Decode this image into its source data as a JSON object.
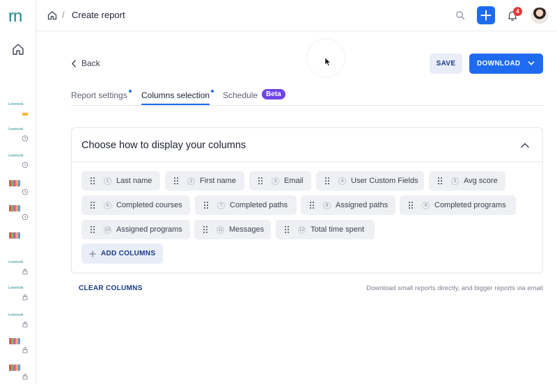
{
  "app": {
    "brand": "rn"
  },
  "header": {
    "breadcrumb_sep": "/",
    "title": "Create report",
    "notification_count": "4"
  },
  "rail": {
    "items": [
      {
        "kind": "text",
        "label": "Learnook",
        "badge": "crown-icon"
      },
      {
        "kind": "text",
        "label": "Learnook",
        "badge": "clock-icon"
      },
      {
        "kind": "text",
        "label": "Learnook",
        "badge": "clock-icon"
      },
      {
        "kind": "image",
        "badge": "clock-icon"
      },
      {
        "kind": "image",
        "badge": "clock-icon"
      },
      {
        "kind": "image",
        "badge": ""
      },
      {
        "kind": "text",
        "label": "Learnook",
        "badge": "lock-icon"
      },
      {
        "kind": "text",
        "label": "Learnook",
        "badge": "lock-icon"
      },
      {
        "kind": "text",
        "label": "Learnook",
        "badge": "lock-icon"
      },
      {
        "kind": "image",
        "badge": "lock-icon"
      },
      {
        "kind": "image",
        "badge": "lock-icon"
      }
    ]
  },
  "toolbar": {
    "back_label": "Back",
    "save_label": "SAVE",
    "download_label": "DOWNLOAD"
  },
  "tabs": [
    {
      "label": "Report settings",
      "active": false,
      "dot": true
    },
    {
      "label": "Columns selection",
      "active": true,
      "dot": true
    },
    {
      "label": "Schedule",
      "active": false,
      "dot": false,
      "badge": "Beta"
    }
  ],
  "card": {
    "title": "Choose how to display your columns",
    "columns": [
      {
        "n": "1",
        "label": "Last name"
      },
      {
        "n": "2",
        "label": "First name"
      },
      {
        "n": "3",
        "label": "Email"
      },
      {
        "n": "4",
        "label": "User Custom Fields"
      },
      {
        "n": "5",
        "label": "Avg score"
      },
      {
        "n": "6",
        "label": "Completed courses"
      },
      {
        "n": "7",
        "label": "Completed paths"
      },
      {
        "n": "8",
        "label": "Assigned paths"
      },
      {
        "n": "9",
        "label": "Completed programs"
      },
      {
        "n": "10",
        "label": "Assigned programs"
      },
      {
        "n": "11",
        "label": "Messages"
      },
      {
        "n": "12",
        "label": "Total time spent"
      }
    ],
    "add_label": "ADD COLUMNS"
  },
  "footer": {
    "clear_label": "CLEAR COLUMNS",
    "note": "Download small reports directly, and bigger reports via email"
  },
  "colors": {
    "primary": "#1f6bf0",
    "beta": "#6f45e8",
    "brand": "#1a8a8f",
    "notif": "#e53935"
  }
}
